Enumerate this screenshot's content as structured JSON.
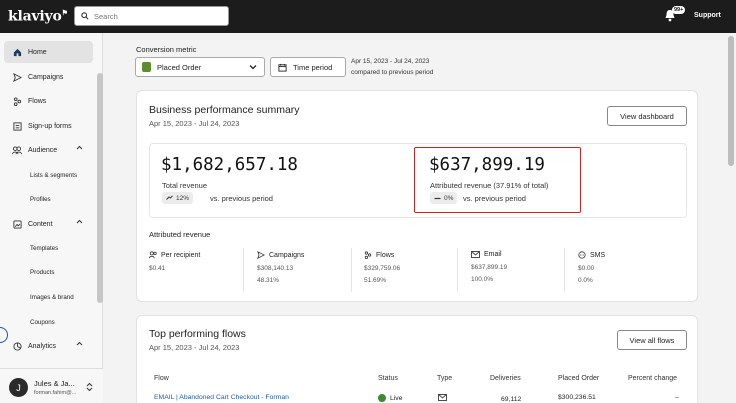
{
  "topbar": {
    "logo": "klaviyo",
    "search_placeholder": "Search",
    "notification_count": "99+",
    "support_label": "Support"
  },
  "sidebar": {
    "items": [
      {
        "label": "Home",
        "icon": "home-icon",
        "active": true
      },
      {
        "label": "Campaigns",
        "icon": "send-icon"
      },
      {
        "label": "Flows",
        "icon": "flows-icon"
      },
      {
        "label": "Sign-up forms",
        "icon": "form-icon"
      },
      {
        "label": "Audience",
        "icon": "people-icon",
        "expanded": true
      },
      {
        "label": "Content",
        "icon": "content-icon",
        "expanded": true
      },
      {
        "label": "Analytics",
        "icon": "analytics-icon",
        "expanded": true
      }
    ],
    "audience_sub": [
      "Lists & segments",
      "Profiles"
    ],
    "content_sub": [
      "Templates",
      "Products",
      "Images & brand",
      "Coupons"
    ],
    "user": {
      "initial": "J",
      "name": "Jules & Ja...",
      "email": "forman.fahim@..."
    }
  },
  "conversion": {
    "label": "Conversion metric",
    "metric_value": "Placed Order",
    "time_button": "Time period",
    "date_range": "Apr 15, 2023 - Jul 24, 2023",
    "compare_text": "compared to previous period"
  },
  "summary": {
    "title": "Business performance summary",
    "date_range": "Apr 15, 2023 - Jul 24, 2023",
    "view_button": "View dashboard",
    "total_revenue": {
      "value": "$1,682,657.18",
      "label": "Total revenue",
      "change": "12%",
      "vs": "vs. previous period"
    },
    "attributed_revenue": {
      "value": "$637,899.19",
      "label": "Attributed revenue (37.91% of total)",
      "change": "0%",
      "vs": "vs. previous period"
    },
    "attributed_title": "Attributed revenue",
    "columns": [
      {
        "label": "Per recipient",
        "icon": "person-icon",
        "value": "$0.41",
        "pct": ""
      },
      {
        "label": "Campaigns",
        "icon": "send-icon",
        "value": "$308,140.13",
        "pct": "48.31%"
      },
      {
        "label": "Flows",
        "icon": "flows-icon",
        "value": "$329,759.06",
        "pct": "51.69%"
      },
      {
        "label": "Email",
        "icon": "email-icon",
        "value": "$637,899.19",
        "pct": "100.0%"
      },
      {
        "label": "SMS",
        "icon": "sms-icon",
        "value": "$0.00",
        "pct": "0.0%"
      }
    ]
  },
  "flows": {
    "title": "Top performing flows",
    "date_range": "Apr 15, 2023 - Jul 24, 2023",
    "view_button": "View all flows",
    "headers": [
      "Flow",
      "Status",
      "Type",
      "Deliveries",
      "Placed Order",
      "Percent change"
    ],
    "row": {
      "flow": "EMAIL | Abandoned Cart Checkout - Forman",
      "status": "Live",
      "deliveries": "69,112",
      "placed_order": "$300,236.51",
      "change": "–"
    }
  },
  "colors": {
    "topbar": "#1c1c1c",
    "highlight": "#d61f1f",
    "link": "#1a5fb4",
    "shopify": "#5a8f29"
  }
}
